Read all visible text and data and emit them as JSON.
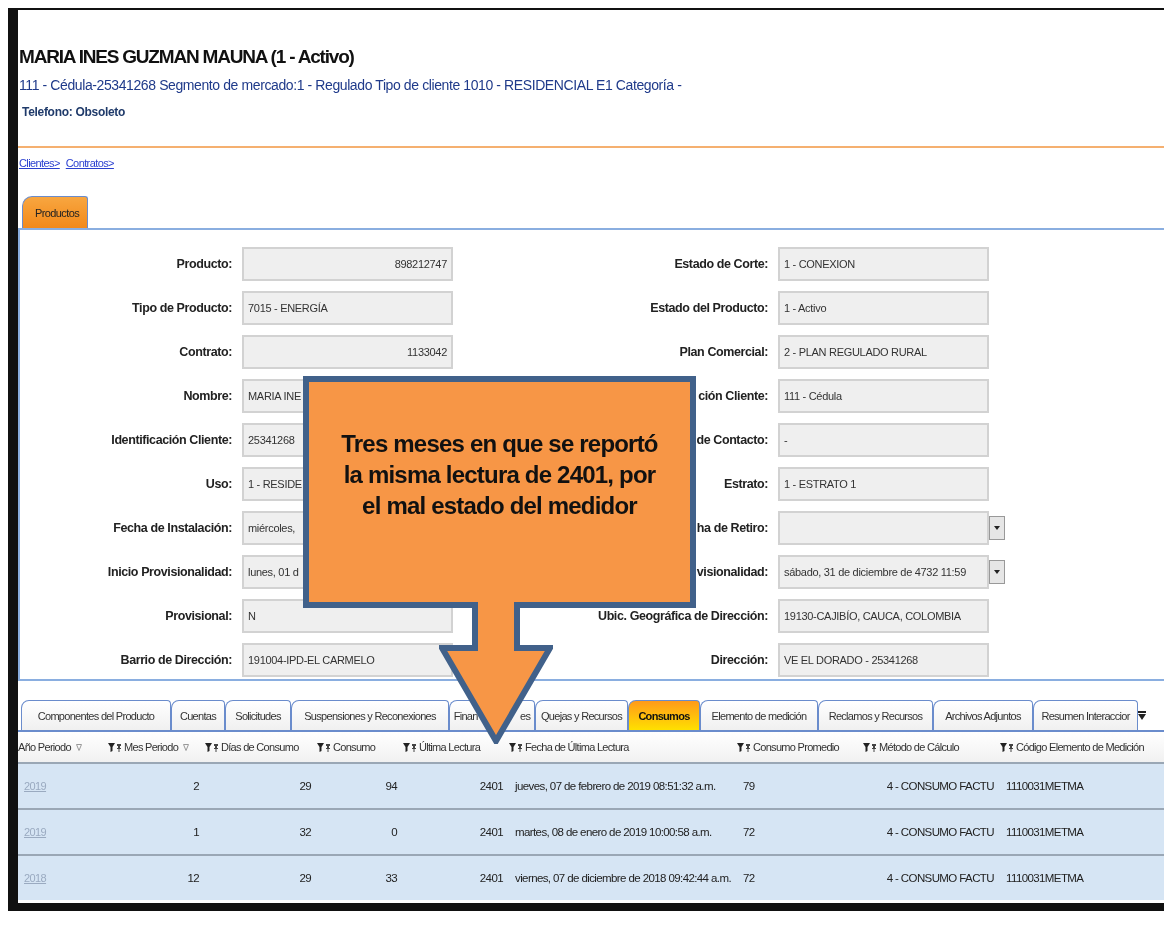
{
  "header": {
    "name": "MARIA INES  GUZMAN MAUNA (1 - Activo)",
    "details": "111 - Cédula-25341268 Segmento de mercado:1 - Regulado Tipo de cliente 1010 - RESIDENCIAL E1 Categoría  -",
    "phone": "Telefono: Obsoleto"
  },
  "breadcrumbs": [
    "Clientes>",
    "Contratos>"
  ],
  "top_tabs": [
    {
      "label": "Productos",
      "selected": true
    }
  ],
  "form_rows": [
    {
      "left": {
        "label": "Producto:",
        "value": "898212747",
        "kind": "number"
      },
      "right": {
        "label": "Estado de Corte:",
        "value": "1 - CONEXION",
        "kind": "text"
      }
    },
    {
      "left": {
        "label": "Tipo de Producto:",
        "value": "7015 - ENERGÍA",
        "kind": "text"
      },
      "right": {
        "label": "Estado del Producto:",
        "value": "1 - Activo",
        "kind": "text"
      }
    },
    {
      "left": {
        "label": "Contrato:",
        "value": "1133042",
        "kind": "number"
      },
      "right": {
        "label": "Plan Comercial:",
        "value": "2 - PLAN REGULADO RURAL",
        "kind": "text"
      }
    },
    {
      "left": {
        "label": "Nombre:",
        "value": "MARIA INE",
        "kind": "text"
      },
      "right": {
        "label": "ción Cliente:",
        "value": "111 - Cédula",
        "kind": "text"
      }
    },
    {
      "left": {
        "label": "Identificación Cliente:",
        "value": "25341268",
        "kind": "text"
      },
      "right": {
        "label": "de Contacto:",
        "value": "-",
        "kind": "text"
      }
    },
    {
      "left": {
        "label": "Uso:",
        "value": "1 - RESIDE",
        "kind": "text"
      },
      "right": {
        "label": "Estrato:",
        "value": "1 - ESTRATO 1",
        "kind": "text"
      }
    },
    {
      "left": {
        "label": "Fecha de Instalación:",
        "value": "miércoles,",
        "kind": "text"
      },
      "right": {
        "label": "ha de Retiro:",
        "kind": "dropdown"
      }
    },
    {
      "left": {
        "label": "Inicio Provisionalidad:",
        "value": "lunes, 01 d",
        "kind": "text"
      },
      "right": {
        "label": "visionalidad:",
        "value": "sábado, 31 de diciembre de 4732 11:59",
        "kind": "dropdown"
      }
    },
    {
      "left": {
        "label": "Provisional:",
        "value": "N",
        "kind": "text"
      },
      "right": {
        "label": "Ubic. Geográfica de Dirección:",
        "value": "19130-CAJIBÍO, CAUCA, COLOMBIA",
        "kind": "text"
      }
    },
    {
      "left": {
        "label": "Barrio de Dirección:",
        "value": "191004-IPD-EL CARMELO",
        "kind": "text"
      },
      "right": {
        "label": "Dirección:",
        "value": "VE EL DORADO - 25341268",
        "kind": "text"
      }
    }
  ],
  "bottom_tabs": [
    {
      "label": "Componentes del Producto",
      "selected": false
    },
    {
      "label": "Cuentas",
      "selected": false
    },
    {
      "label": "Solicitudes",
      "selected": false
    },
    {
      "label": "Suspensiones y Reconexiones",
      "selected": false
    },
    {
      "label": "Finan                  es",
      "selected": false
    },
    {
      "label": "Quejas y Recursos",
      "selected": false
    },
    {
      "label": "Consumos",
      "selected": true
    },
    {
      "label": "Elemento de medición",
      "selected": false
    },
    {
      "label": "Reclamos y Recursos",
      "selected": false
    },
    {
      "label": "Archivos Adjuntos",
      "selected": false
    },
    {
      "label": "Resumen Interaccior",
      "selected": false
    }
  ],
  "table": {
    "columns": [
      {
        "label": "Año Periodo",
        "sort_marker": true,
        "filter": false
      },
      {
        "label": "Mes Periodo",
        "sort_marker": true,
        "filter": true
      },
      {
        "label": "Días de Consumo",
        "sort_marker": false,
        "filter": true
      },
      {
        "label": "Consumo",
        "sort_marker": false,
        "filter": true
      },
      {
        "label": "Última Lectura",
        "sort_marker": false,
        "filter": true
      },
      {
        "label": "Fecha de Última Lectura",
        "sort_marker": false,
        "filter": true
      },
      {
        "label": "Consumo Promedio",
        "sort_marker": false,
        "filter": true
      },
      {
        "label": "Método de Cálculo",
        "sort_marker": false,
        "filter": true
      },
      {
        "label": "Código Elemento de Medición",
        "sort_marker": false,
        "filter": true
      }
    ],
    "rows": [
      [
        "2019",
        "2",
        "29",
        "94",
        "2401",
        "jueves, 07 de febrero de 2019 08:51:32 a.m.",
        "79",
        "4 - CONSUMO FACTU",
        "1110031METMA"
      ],
      [
        "2019",
        "1",
        "32",
        "0",
        "2401",
        "martes, 08 de enero de 2019 10:00:58 a.m.",
        "72",
        "4 - CONSUMO FACTU",
        "1110031METMA"
      ],
      [
        "2018",
        "12",
        "29",
        "33",
        "2401",
        "viernes, 07 de diciembre de 2018 09:42:44 a.m.",
        "72",
        "4 - CONSUMO FACTU",
        "1110031METMA"
      ]
    ]
  },
  "callout": {
    "text": "Tres meses en que se reportó la misma lectura de 2401, por el mal estado del medidor"
  }
}
